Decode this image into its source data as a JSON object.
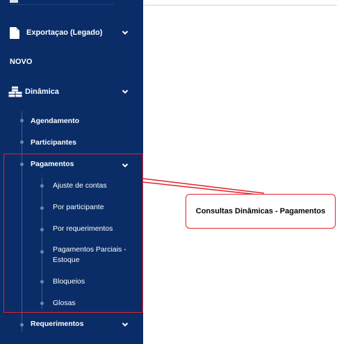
{
  "sidebar": {
    "exportacao": {
      "label": "Exportaçao (Legado)",
      "icon": "file-icon"
    },
    "novo": {
      "label": "NOVO"
    },
    "dinamica": {
      "label": "Dinâmica",
      "icon": "cubes-icon",
      "children": [
        {
          "label": "Agendamento"
        },
        {
          "label": "Participantes"
        },
        {
          "label": "Pagamentos",
          "children": [
            {
              "label": "Ajuste de contas"
            },
            {
              "label": "Por participante"
            },
            {
              "label": "Por requerimentos"
            },
            {
              "label": "Pagamentos Parciais -",
              "label2": "Estoque"
            },
            {
              "label": "Bloqueios"
            },
            {
              "label": "Glosas"
            }
          ]
        },
        {
          "label": "Requerimentos"
        }
      ]
    }
  },
  "annotation": {
    "callout_text": "Consultas Dinâmicas - Pagamentos",
    "color": "#e3202c"
  },
  "colors": {
    "sidebar_bg": "#0a2d68",
    "tree_line": "#3d5f95"
  }
}
